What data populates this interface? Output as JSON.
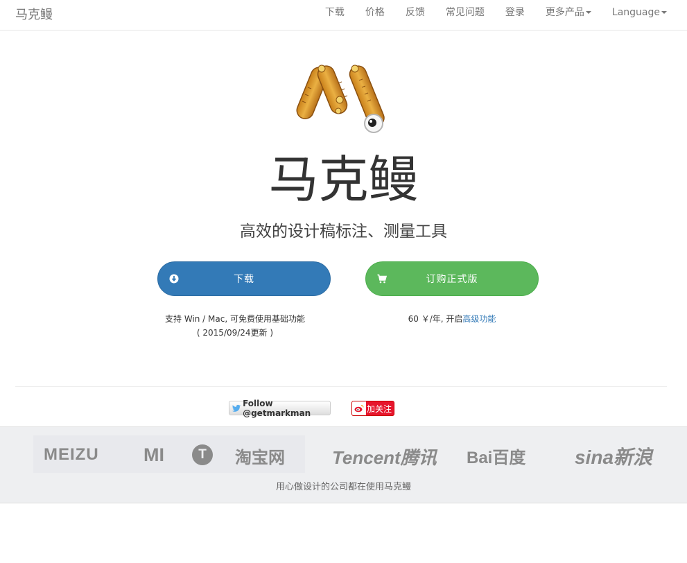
{
  "navbar": {
    "brand": "马克鳗",
    "items": [
      {
        "label": "下载"
      },
      {
        "label": "价格"
      },
      {
        "label": "反馈"
      },
      {
        "label": "常见问题"
      },
      {
        "label": "登录"
      },
      {
        "label": "更多产品"
      },
      {
        "label": "Language"
      }
    ]
  },
  "hero": {
    "title": "马克鳗",
    "subtitle": "高效的设计稿标注、测量工具",
    "download_button": "下载",
    "buy_button": "订购正式版",
    "download_note_line1": "支持 Win / Mac, 可免费使用基础功能",
    "download_note_line2": "( 2015/09/24更新 )",
    "buy_note_prefix": "60 ￥/年, 开启",
    "buy_note_link": "高级功能"
  },
  "social": {
    "twitter_follow": "Follow @getmarkman",
    "weibo_follow": "加关注"
  },
  "clients": {
    "logos": [
      "MEIZU",
      "MI",
      "T",
      "淘宝网",
      "Tencent腾讯",
      "Bai百度",
      "sina新浪"
    ],
    "caption": "用心做设计的公司都在使用马克鳗"
  },
  "colors": {
    "primary": "#337ab7",
    "success": "#5cb85c",
    "weibo_red": "#e6162d",
    "logo_orange": "#e1a124"
  }
}
